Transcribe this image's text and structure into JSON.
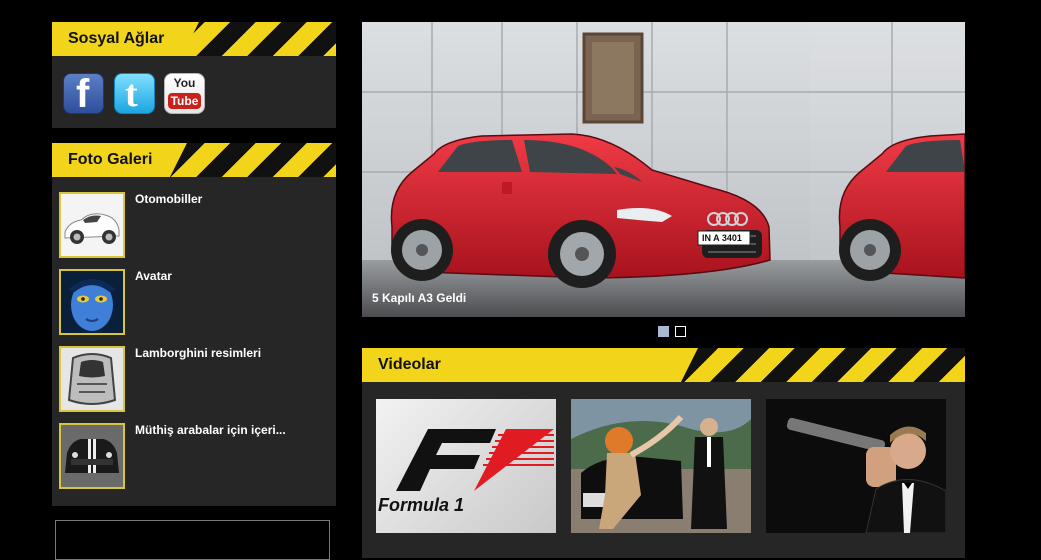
{
  "social": {
    "title": "Sosyal Ağlar",
    "icons": [
      {
        "name": "facebook-icon",
        "glyph": "f"
      },
      {
        "name": "twitter-icon",
        "glyph": "t"
      },
      {
        "name": "youtube-icon",
        "line1": "You",
        "line2": "Tube"
      }
    ]
  },
  "gallery": {
    "title": "Foto Galeri",
    "items": [
      {
        "title": "Otomobiller"
      },
      {
        "title": "Avatar"
      },
      {
        "title": "Lamborghini resimleri"
      },
      {
        "title": "Müthiş arabalar için içeri..."
      }
    ]
  },
  "slider": {
    "caption": "5 Kapılı A3 Geldi",
    "plate": "IN A 3401",
    "active_index": 0,
    "dot_count": 2
  },
  "videos": {
    "title": "Videolar",
    "f1_text": "Formula 1",
    "items": [
      {
        "name": "formula1-video-thumb"
      },
      {
        "name": "car-fashion-video-thumb"
      },
      {
        "name": "james-bond-video-thumb"
      }
    ]
  },
  "colors": {
    "accent": "#f2d41a",
    "panel": "#262626",
    "background": "#000000",
    "car_red": "#d71f2e"
  }
}
